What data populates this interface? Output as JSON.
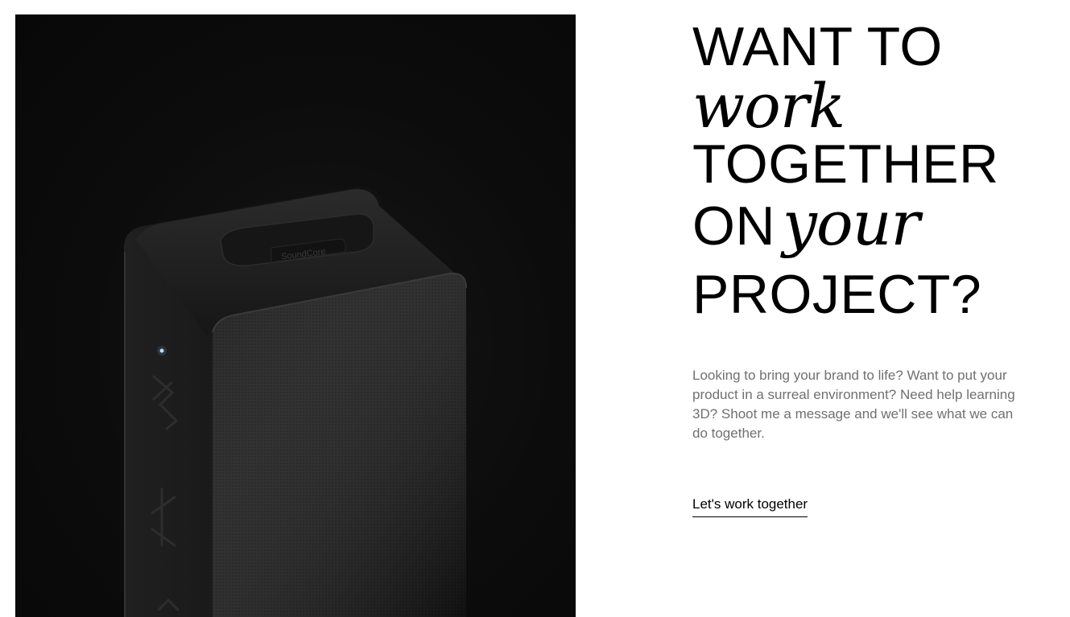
{
  "hero": {
    "product_brand_text": "SoundCore"
  },
  "headline": {
    "line1": "WANT TO",
    "line2": "work",
    "line3": "TOGETHER",
    "line4_sans": "ON",
    "line4_italic": "your",
    "line5": "PROJECT?"
  },
  "description": "Looking to bring your brand to life? Want to put your product in a surreal environment? Need help learning 3D? Shoot me a message and we'll see what we can do together.",
  "cta": {
    "label": "Let's work together"
  },
  "colors": {
    "background": "#ffffff",
    "headline": "#000000",
    "body_text": "#707070",
    "image_background": "#0c0c0c"
  }
}
